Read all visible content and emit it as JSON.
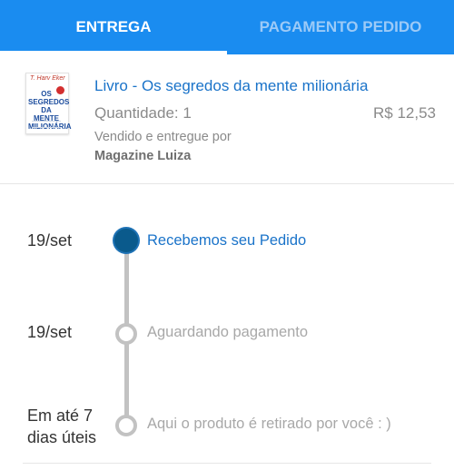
{
  "tabs": {
    "delivery": "ENTREGA",
    "payment": "PAGAMENTO PEDIDO"
  },
  "product": {
    "cover_author": "T. Harv Eker",
    "cover_title": "OS SEGREDOS DA MENTE MILIONÁRIA",
    "name": "Livro - Os segredos da mente milionária",
    "quantity": "Quantidade: 1",
    "price": "R$ 12,53",
    "sold_by": "Vendido e entregue por",
    "seller": "Magazine Luiza"
  },
  "timeline": [
    {
      "date": "19/set",
      "label": "Recebemos seu Pedido",
      "status": "done"
    },
    {
      "date": "19/set",
      "label": "Aguardando pagamento",
      "status": "pending"
    },
    {
      "date_line1": "Em até 7",
      "date_line2": "dias úteis",
      "label": "Aqui o produto é retirado por você : )",
      "status": "pending"
    }
  ],
  "colors": {
    "header_bg": "#1a8cf0",
    "active_text": "#1a73c9",
    "active_dot": "#0a5a8c",
    "inactive": "#c2c2c2"
  }
}
